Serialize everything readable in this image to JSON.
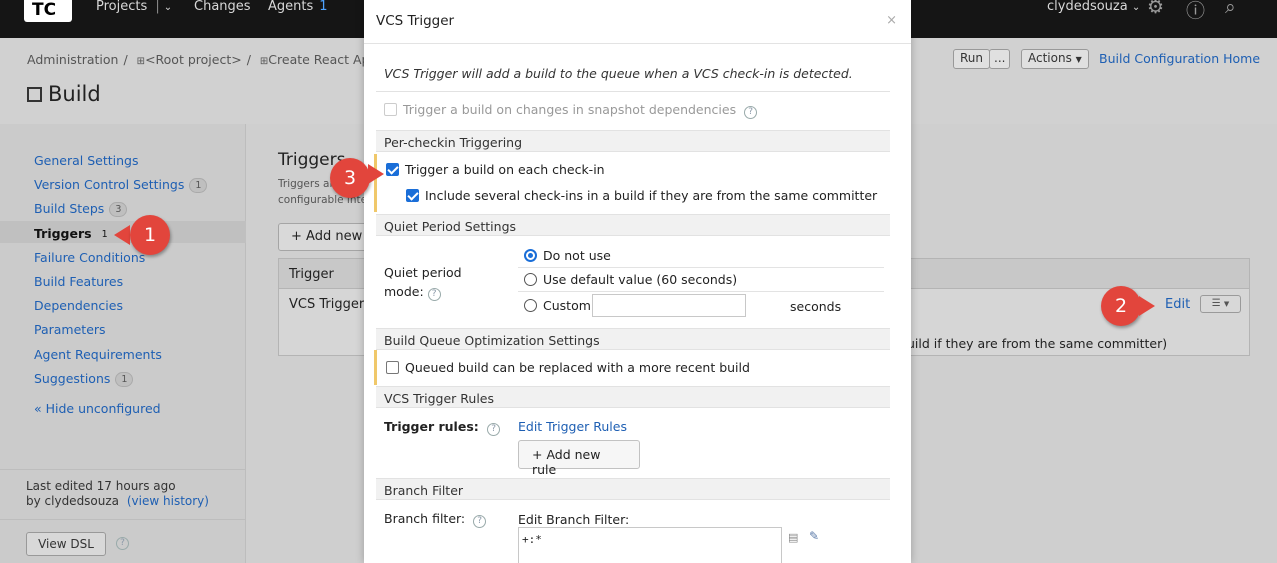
{
  "topbar": {
    "logo": "TC",
    "projects": "Projects",
    "projects_sep": "|",
    "changes": "Changes",
    "agents": "Agents",
    "agents_count": "1",
    "username": "clydedsouza"
  },
  "breadcrumb": {
    "items": [
      "Administration",
      "<Root project>",
      "Create React App"
    ],
    "sep": "/"
  },
  "page": {
    "title": "Build",
    "run_label": "Run",
    "run_more": "...",
    "actions_label": "Actions",
    "home_link": "Build Configuration Home"
  },
  "sidebar": {
    "items": [
      {
        "label": "General Settings",
        "badge": ""
      },
      {
        "label": "Version Control Settings",
        "badge": "1"
      },
      {
        "label": "Build Steps",
        "badge": "3"
      },
      {
        "label": "Triggers",
        "badge": "1"
      },
      {
        "label": "Failure Conditions",
        "badge": ""
      },
      {
        "label": "Build Features",
        "badge": ""
      },
      {
        "label": "Dependencies",
        "badge": ""
      },
      {
        "label": "Parameters",
        "badge": ""
      },
      {
        "label": "Agent Requirements",
        "badge": ""
      },
      {
        "label": "Suggestions",
        "badge": "1"
      }
    ],
    "hide_unconfigured": "« Hide unconfigured",
    "last_edited": "Last edited 17 hours ago",
    "by_user": "by clydedsouza",
    "view_history": "(view history)",
    "view_dsl": "View DSL"
  },
  "main": {
    "title": "Triggers",
    "desc_line1": "Triggers are",
    "desc_line2": "configurable inte",
    "add_new_label": "+ Add new",
    "table_header": "Trigger",
    "row_trigger": "VCS Trigger",
    "row_desc_tail": "uild if they are from the same committer)",
    "edit_label": "Edit"
  },
  "dialog": {
    "title": "VCS Trigger",
    "close": "×",
    "intro": "VCS Trigger will add a build to the queue when a VCS check-in is detected.",
    "snapshot_label": "Trigger a build on changes in snapshot dependencies",
    "per_checkin_section": "Per-checkin Triggering",
    "per_checkin_label": "Trigger a build on each check-in",
    "include_several_label": "Include several check-ins in a build if they are from the same committer",
    "quiet_section": "Quiet Period Settings",
    "quiet_label_1": "Quiet period",
    "quiet_label_2": "mode:",
    "quiet_options": [
      "Do not use",
      "Use default value (60 seconds)",
      "Custom"
    ],
    "seconds_label": "seconds",
    "queue_section": "Build Queue Optimization Settings",
    "queued_label": "Queued build can be replaced with a more recent build",
    "rules_section": "VCS Trigger Rules",
    "trigger_rules_label": "Trigger rules:",
    "edit_trigger_rules": "Edit Trigger Rules",
    "add_new_rule": "+ Add new rule",
    "branch_section": "Branch Filter",
    "branch_filter_label": "Branch filter:",
    "edit_branch_filter": "Edit Branch Filter:",
    "branch_filter_value": "+:*"
  },
  "callouts": [
    "1",
    "2",
    "3"
  ],
  "colors": {
    "callout": "#e2453c",
    "link": "#1e5fb3",
    "checkbox_on": "#1a6ed8",
    "highlight_bar": "#f0c86a"
  }
}
